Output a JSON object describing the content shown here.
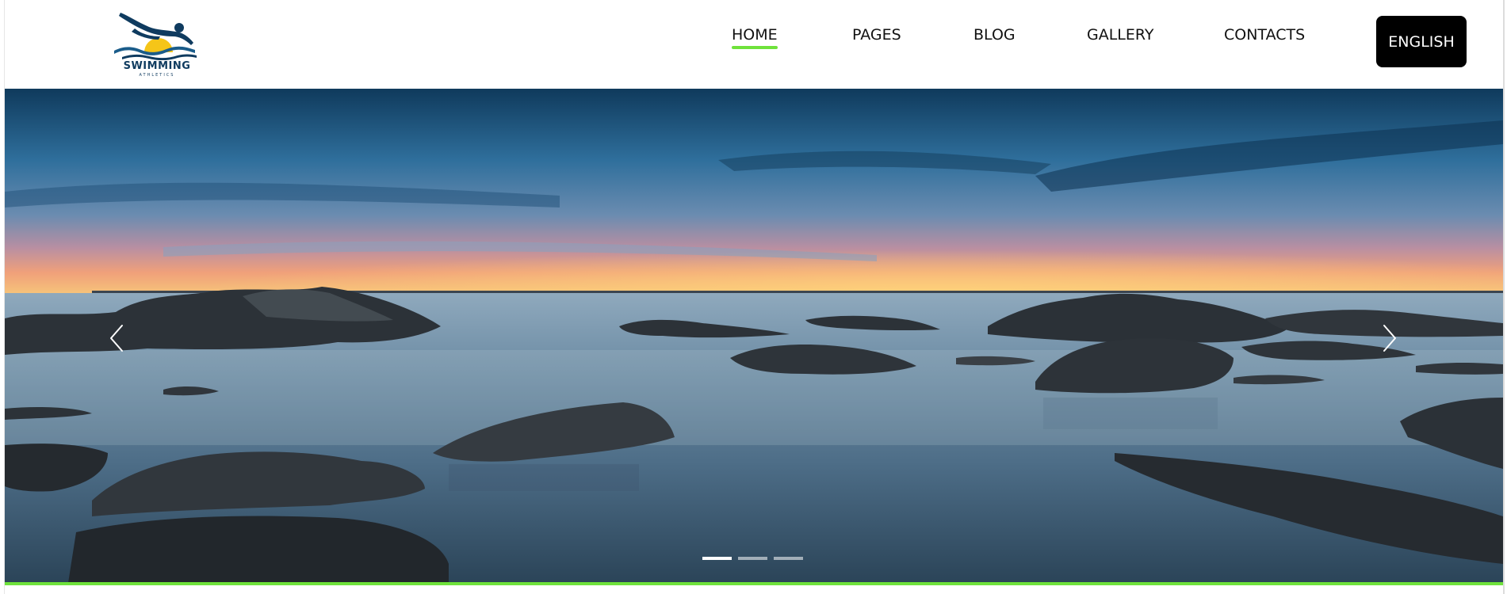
{
  "logo": {
    "text": "SWIMMING",
    "subtext": "ATHLETICS",
    "icon": "swimmer-logo"
  },
  "nav": {
    "items": [
      {
        "label": "HOME",
        "active": true
      },
      {
        "label": "PAGES",
        "active": false
      },
      {
        "label": "BLOG",
        "active": false
      },
      {
        "label": "GALLERY",
        "active": false
      },
      {
        "label": "CONTACTS",
        "active": false
      }
    ],
    "language_button": "ENGLISH"
  },
  "slider": {
    "image": "seascape-sunset-rocks",
    "prev_icon": "chevron-left-icon",
    "next_icon": "chevron-right-icon",
    "slide_count": 3,
    "active_slide": 1
  },
  "colors": {
    "accent": "#6fe23b",
    "button_bg": "#000000",
    "logo_blue": "#0f3b5f",
    "logo_sun": "#f5c518"
  }
}
